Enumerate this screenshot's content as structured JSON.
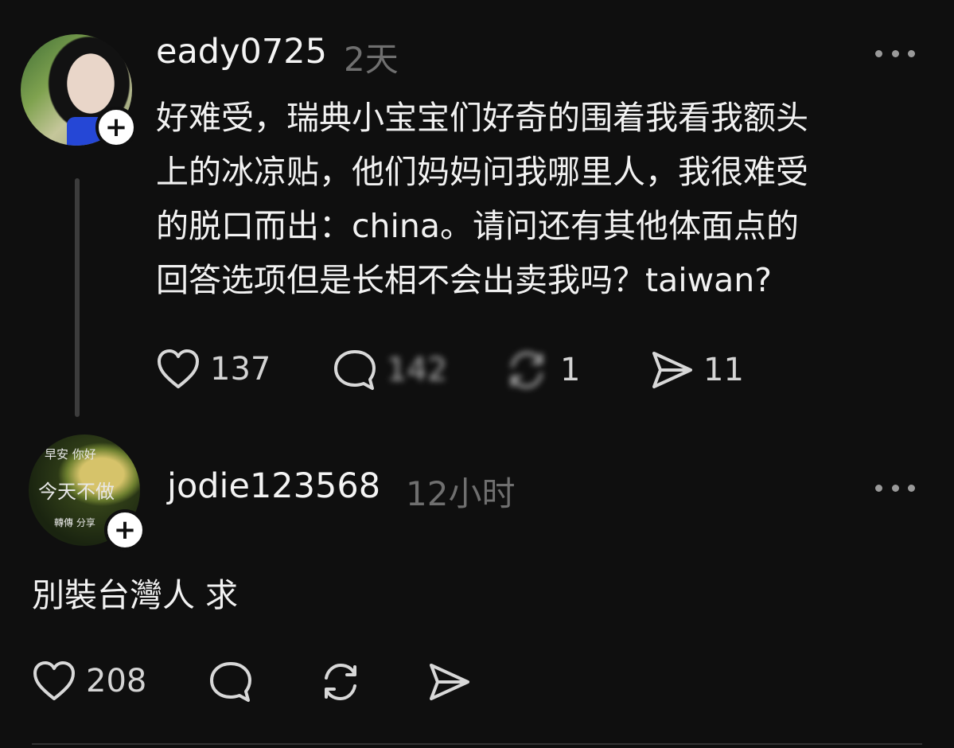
{
  "posts": [
    {
      "username": "eady0725",
      "time": "2天",
      "text": "好难受，瑞典小宝宝们好奇的围着我看我额头\n上的冰凉贴，他们妈妈问我哪里人，我很难受\n的脱口而出：china。请问还有其他体面点的\n回答选项但是长相不会出卖我吗？taiwan?",
      "likes": "137",
      "comments": "142",
      "reposts": "1",
      "shares": "11"
    },
    {
      "username": "jodie123568",
      "time": "12小时",
      "avatar_text": [
        "早安 你好",
        "今天不做",
        "轉傳 分享"
      ],
      "text": "別裝台灣人 求",
      "likes": "208",
      "comments": "",
      "reposts": "",
      "shares": ""
    }
  ],
  "icons": {
    "follow": "+",
    "more": "more-icon",
    "like": "heart-icon",
    "comment": "comment-icon",
    "repost": "repost-icon",
    "share": "send-icon"
  },
  "colors": {
    "background": "#0f0f0f",
    "text": "#f2f2f2",
    "muted": "#6f6f6f"
  }
}
